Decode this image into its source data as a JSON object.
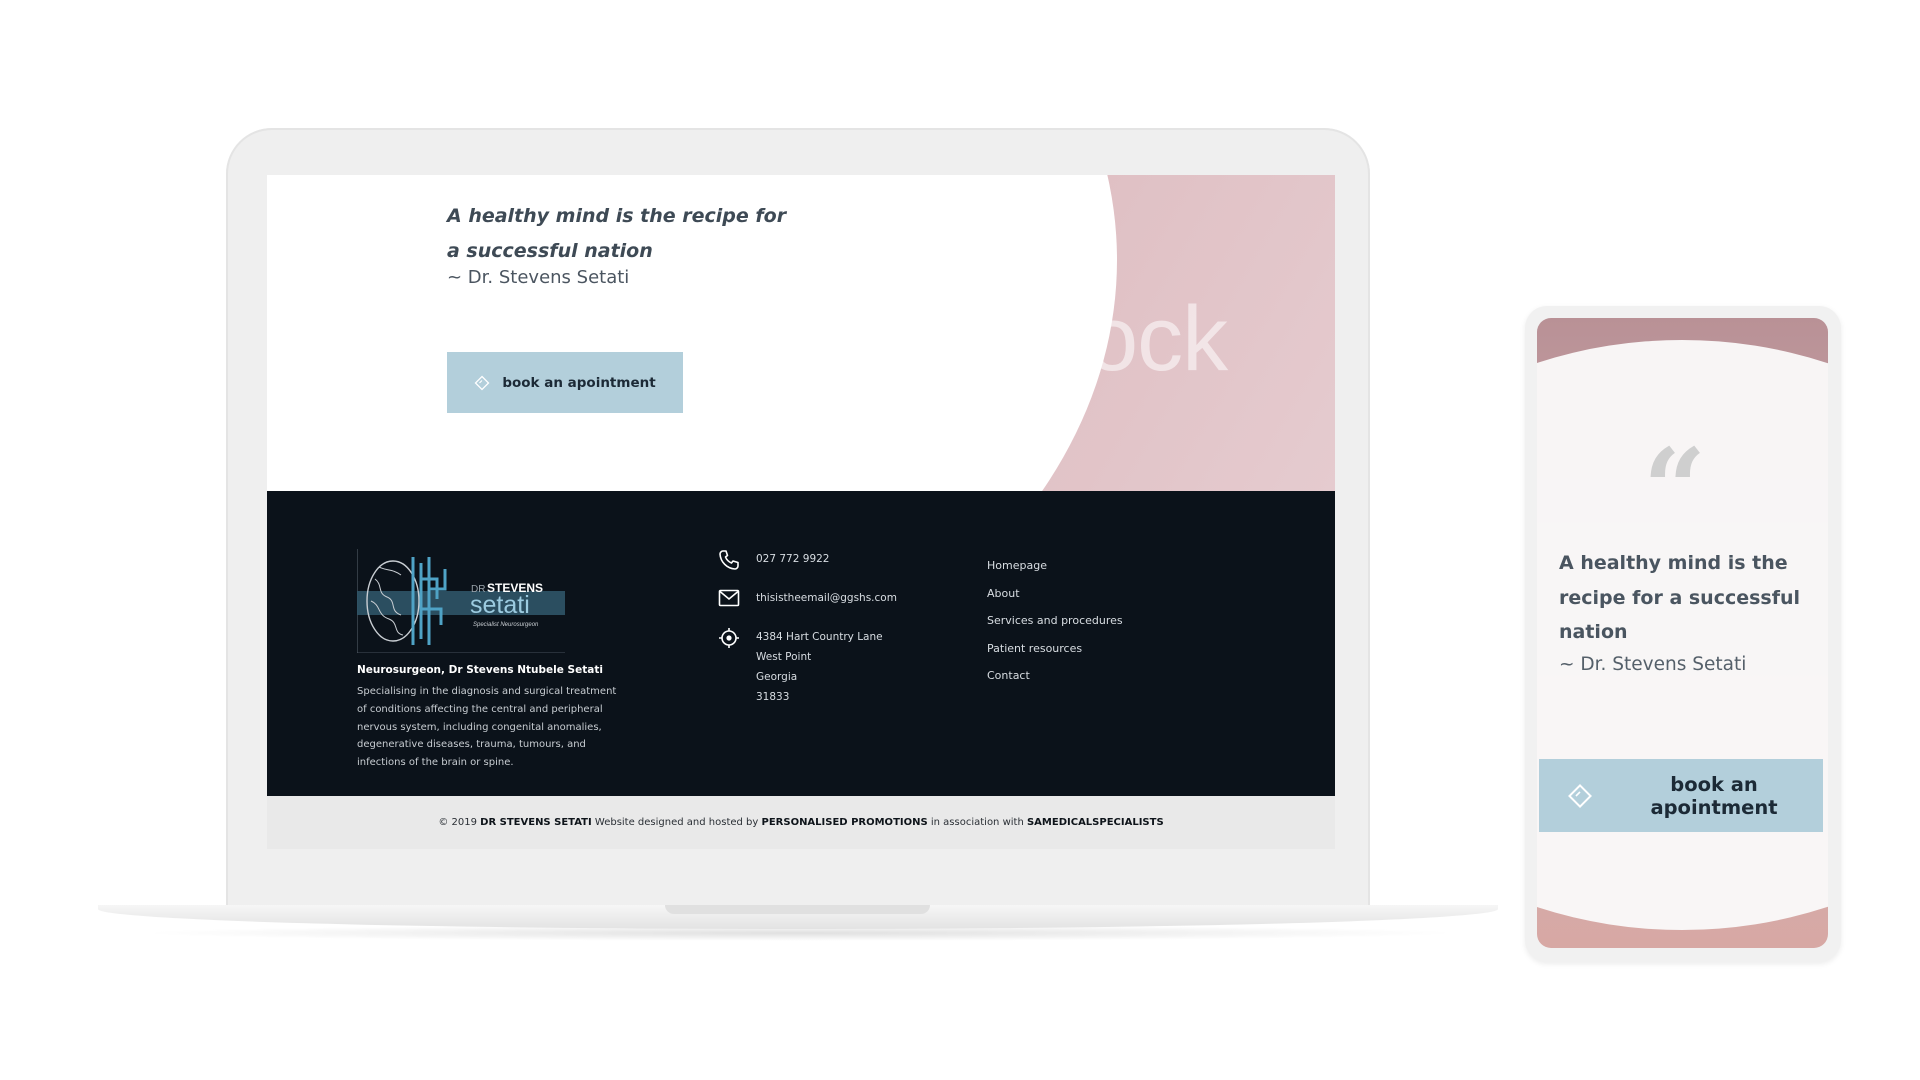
{
  "hero": {
    "quote": "A healthy mind is the recipe for a successful nation",
    "author": "~ Dr. Stevens Setati",
    "button_label": "book an apointment",
    "watermark": "obe Stock"
  },
  "logo": {
    "line1_prefix": "DR",
    "line1_name": "STEVENS",
    "line2": "setati",
    "tagline": "Specialist Neurosurgeon"
  },
  "footer": {
    "about_title": "Neurosurgeon, Dr Stevens Ntubele Setati",
    "about_text": "Specialising in the diagnosis and surgical treatment of conditions affecting the central and peripheral nervous system, including congenital anomalies, degenerative diseases, trauma, tumours, and infections of the brain or spine.",
    "phone": "027 772 9922",
    "email": "thisistheemail@ggshs.com",
    "address": [
      "4384 Hart Country Lane",
      "West Point",
      "Georgia",
      "31833"
    ],
    "links": [
      "Homepage",
      "About",
      "Services and procedures",
      "Patient resources",
      "Contact"
    ]
  },
  "copyright": {
    "prefix": "© 2019",
    "owner": "DR STEVENS SETATI",
    "mid": "Website designed and hosted by",
    "designer": "PERSONALISED PROMOTIONS",
    "assoc": "in association with",
    "partner": "SAMEDICALSPECIALISTS"
  },
  "phone_view": {
    "quote": "A healthy mind is the recipe for a successful nation",
    "author": "~ Dr. Stevens Setati",
    "button_label": "book an apointment"
  },
  "colors": {
    "accent": "#b3cfdb",
    "footer_bg": "#0b121a",
    "hero_pink": "#d9aeb1",
    "text_dark": "#3e4a55"
  }
}
